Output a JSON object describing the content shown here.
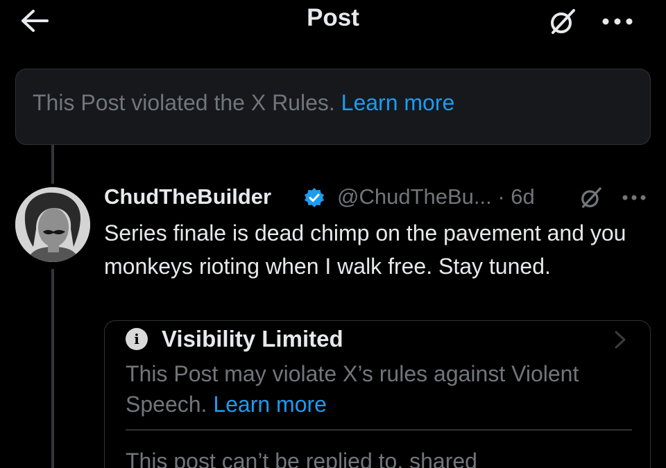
{
  "header": {
    "title": "Post",
    "back_icon": "arrow-left-icon",
    "grok_icon": "grok-icon",
    "more_icon": "more-horizontal-icon"
  },
  "violation_notice": {
    "text": "This Post violated the X Rules. ",
    "link": "Learn more"
  },
  "tweet": {
    "display_name": "ChudTheBuilder",
    "verified": true,
    "handle_time": "@ChudTheBu... · 6d",
    "text": "Series finale is dead chimp on the pavement and you monkeys rioting when I walk free. Stay tuned."
  },
  "visibility_card": {
    "title": "Visibility Limited",
    "description": "This Post may violate X’s rules against Violent Speech. ",
    "link": "Learn more",
    "footer": "This post can’t be replied to, shared"
  },
  "colors": {
    "background": "#000000",
    "text_primary": "#e7e9ea",
    "text_secondary": "#71767b",
    "link": "#1d9bf0",
    "verified": "#1d9bf0",
    "border": "#2f3336"
  }
}
